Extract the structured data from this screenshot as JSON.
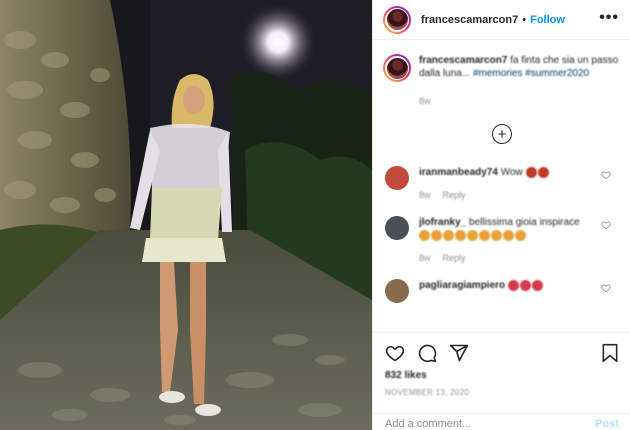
{
  "photo": {
    "alt": ""
  },
  "header": {
    "username": "francescamarcon7",
    "separator": "•",
    "follow_label": "Follow",
    "more_label": "•••"
  },
  "caption": {
    "username": "francescamarcon7",
    "text": "fa finta che sia un passo dalla luna...",
    "hashtags": "#memories #summer2020",
    "age": "8w"
  },
  "load_more_label": "+",
  "comments": [
    {
      "username": "iranmanbeady74",
      "text": "Wow",
      "meta": [
        "8w",
        "Reply"
      ],
      "avatar_color": "#c44a3a",
      "emoji_colors": [
        "#c0392b",
        "#c0392b"
      ]
    },
    {
      "username": "jlofranky_",
      "text": "bellissima gioia inspirace",
      "meta": [
        "8w",
        "Reply"
      ],
      "avatar_color": "#4a4f58",
      "emoji_colors": [
        "#e8a23a",
        "#e8a23a",
        "#e8a23a",
        "#e8a23a",
        "#e8a23a",
        "#e8a23a",
        "#e8a23a",
        "#e8a23a",
        "#e8a23a"
      ]
    },
    {
      "username": "pagliaragiampiero",
      "text": "",
      "meta": [],
      "avatar_color": "#8a6b4f",
      "emoji_colors": [
        "#d63a4a",
        "#d63a4a",
        "#d63a4a"
      ]
    }
  ],
  "actions": {
    "likes": "832 likes",
    "date": "NOVEMBER 13, 2020"
  },
  "add_comment": {
    "placeholder": "Add a comment...",
    "post_label": "Post"
  },
  "colors": {
    "accent": "#0095f6",
    "post_disabled": "#b2dffc",
    "text": "#262626",
    "muted": "#8e8e8e"
  }
}
